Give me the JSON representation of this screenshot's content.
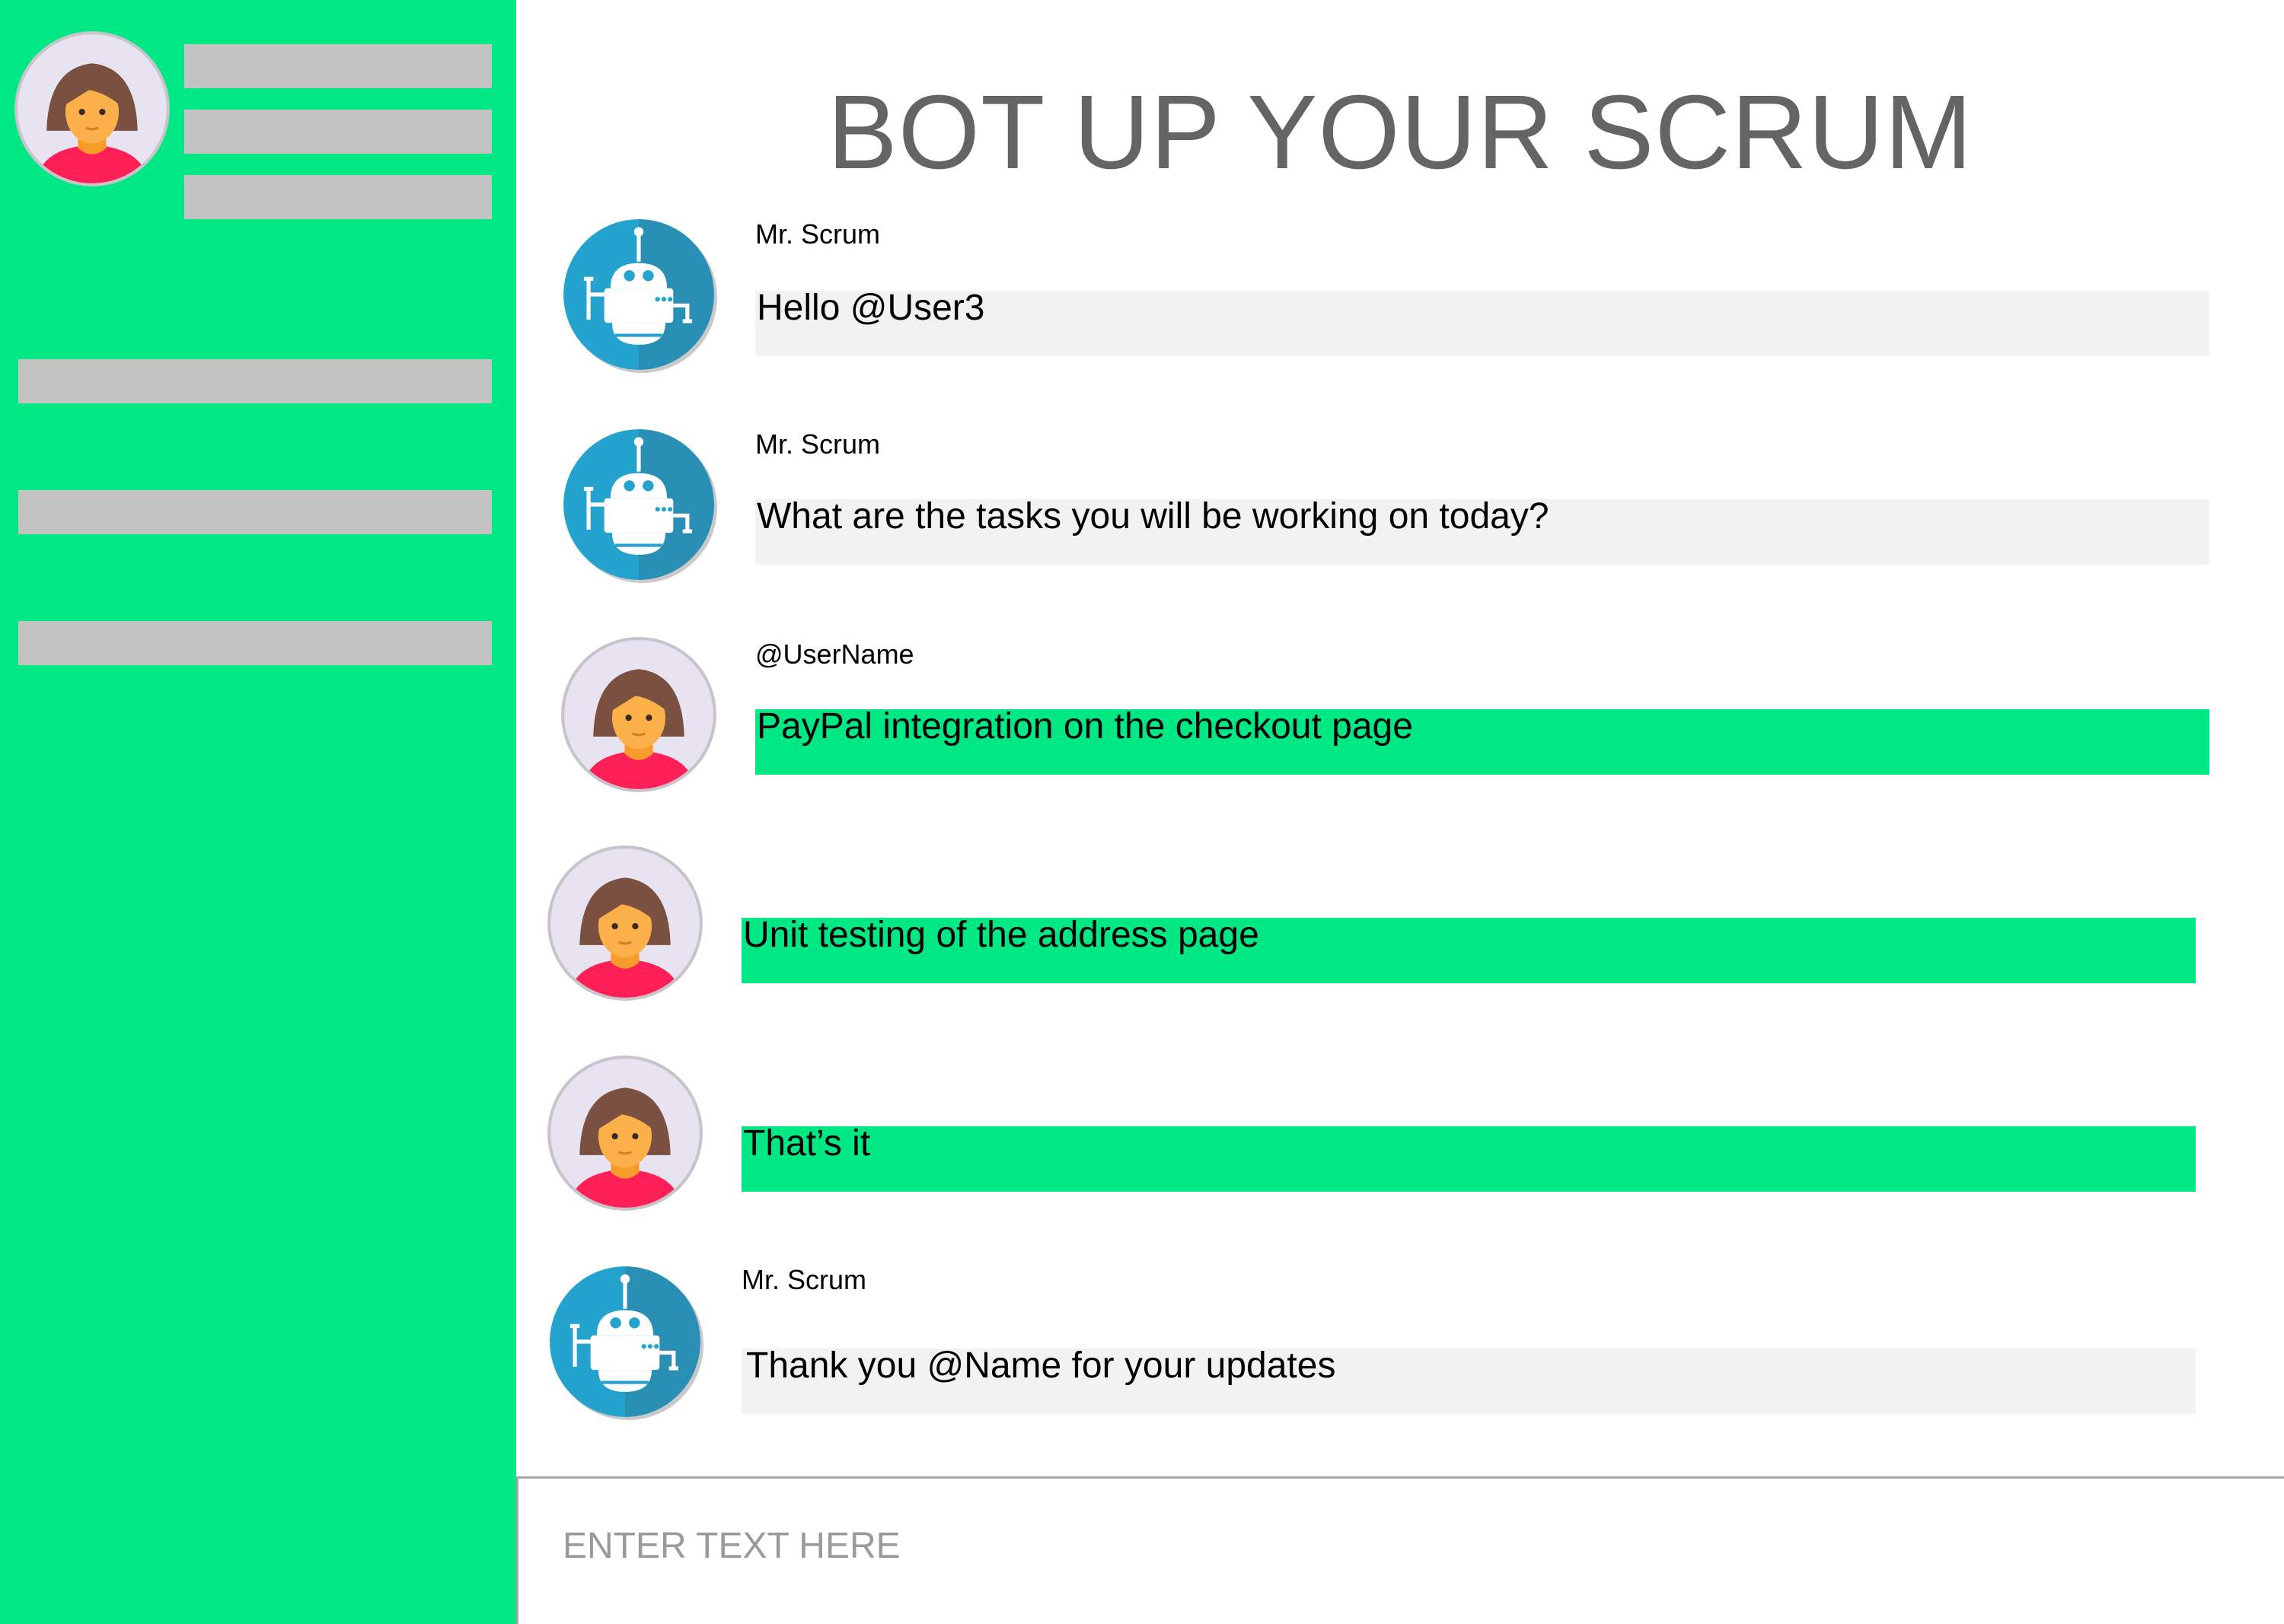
{
  "app": {
    "title": "BOT UP YOUR SCRUM"
  },
  "colors": {
    "accent": "#00e884",
    "placeholder_bar": "#c4c4c4",
    "bot_bubble": "#f2f2f2",
    "title": "#646464",
    "bot_avatar": "#1fa2cc"
  },
  "sidebar": {
    "profile_avatar_icon": "woman-avatar-icon",
    "profile_lines": [
      "",
      "",
      ""
    ],
    "nav_items": [
      "",
      "",
      ""
    ]
  },
  "messages": [
    {
      "sender": "Mr. Scrum",
      "role": "bot",
      "avatar": "robot-avatar-icon",
      "text": "Hello @User3"
    },
    {
      "sender": "Mr. Scrum",
      "role": "bot",
      "avatar": "robot-avatar-icon",
      "text": "What are the tasks you will be working on today?"
    },
    {
      "sender": "@UserName",
      "role": "user",
      "avatar": "woman-avatar-icon",
      "text": "PayPal integration on the checkout page"
    },
    {
      "sender": "",
      "role": "user",
      "avatar": "woman-avatar-icon",
      "text": "Unit testing of the address page"
    },
    {
      "sender": "",
      "role": "user",
      "avatar": "woman-avatar-icon",
      "text": "That’s it"
    },
    {
      "sender": "Mr. Scrum",
      "role": "bot",
      "avatar": "robot-avatar-icon",
      "text": "Thank you @Name for your updates"
    }
  ],
  "composer": {
    "placeholder": "ENTER TEXT HERE",
    "value": ""
  }
}
